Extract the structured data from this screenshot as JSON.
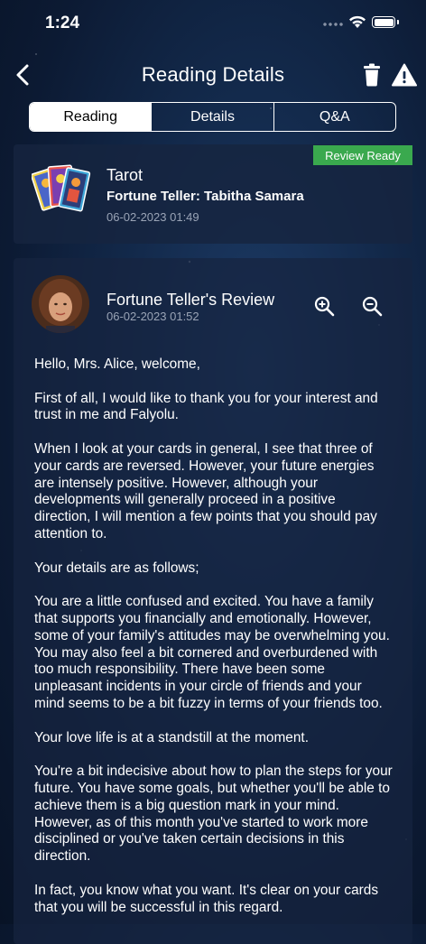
{
  "status": {
    "time": "1:24"
  },
  "header": {
    "title": "Reading Details"
  },
  "tabs": [
    {
      "label": "Reading"
    },
    {
      "label": "Details"
    },
    {
      "label": "Q&A"
    }
  ],
  "reading": {
    "badge": "Review Ready",
    "type": "Tarot",
    "teller": "Fortune Teller: Tabitha Samara",
    "date": "06-02-2023 01:49"
  },
  "review": {
    "title": "Fortune Teller's Review",
    "date": "06-02-2023 01:52",
    "paragraphs": [
      "Hello, Mrs. Alice, welcome,",
      "First of all, I would like to thank you for your interest and trust in me and Falyolu.",
      "When I look at your cards in general, I see that three of your cards are reversed. However, your future energies are intensely positive. However, although your developments will generally proceed in a positive direction, I will mention a few points that you should pay attention to.",
      "Your details are as follows;",
      "You are a little confused and excited. You have a family that supports you financially and emotionally. However, some of your family's attitudes may be overwhelming you. You may also feel a bit cornered and overburdened with too much responsibility. There have been some unpleasant incidents in your circle of friends and your mind seems to be a bit fuzzy in terms of your friends too.",
      "Your love life is at a standstill at the moment.",
      "You're a bit indecisive about how to plan the steps for your future. You have some goals, but whether you'll be able to achieve them is a big question mark in your mind. However, as of this month you've started to work more disciplined or you've taken certain decisions in this direction.",
      "In fact, you know what you want. It's clear on your cards that you will be successful in this regard."
    ]
  },
  "colors": {
    "badge": "#3aa94e",
    "background": "#132a4c",
    "muted": "#9aa4b6"
  }
}
